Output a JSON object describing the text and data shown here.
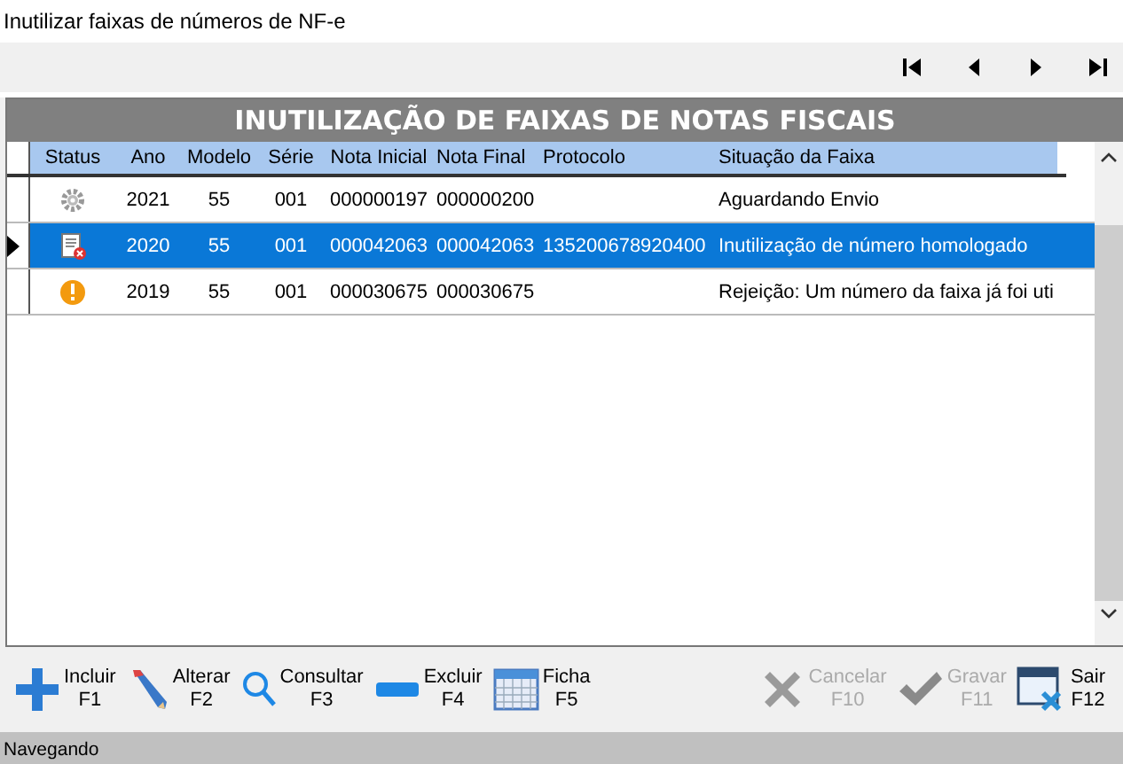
{
  "window": {
    "title": "Inutilizar faixas de números de NF-e"
  },
  "navigator": [
    {
      "kind": "first"
    },
    {
      "kind": "prev"
    },
    {
      "kind": "next"
    },
    {
      "kind": "last"
    }
  ],
  "grid": {
    "title": "INUTILIZAÇÃO DE FAIXAS DE NOTAS FISCAIS",
    "columns": [
      "Status",
      "Ano",
      "Modelo",
      "Série",
      "Nota Inicial",
      "Nota Final",
      "Protocolo",
      "Situação da Faixa"
    ],
    "rows": [
      {
        "kind": "processing",
        "selected": false,
        "cells": [
          "",
          "2021",
          "55",
          "001",
          "000000197",
          "000000200",
          "",
          "Aguardando Envio"
        ]
      },
      {
        "kind": "cancelled",
        "selected": true,
        "cells": [
          "",
          "2020",
          "55",
          "001",
          "000042063",
          "000042063",
          "135200678920400",
          "Inutilização de número homologado"
        ]
      },
      {
        "kind": "warning",
        "selected": false,
        "cells": [
          "",
          "2019",
          "55",
          "001",
          "000030675",
          "000030675",
          "",
          "Rejeição: Um número da faixa já foi uti"
        ]
      }
    ]
  },
  "toolbar": [
    {
      "kind": "add",
      "label": "Incluir",
      "key": "F1",
      "disabled": false
    },
    {
      "kind": "edit",
      "label": "Alterar",
      "key": "F2",
      "disabled": false
    },
    {
      "kind": "search",
      "label": "Consultar",
      "key": "F3",
      "disabled": false
    },
    {
      "kind": "remove",
      "label": "Excluir",
      "key": "F4",
      "disabled": false
    },
    {
      "kind": "form",
      "label": "Ficha",
      "key": "F5",
      "disabled": false
    },
    {
      "kind": "cancel",
      "label": "Cancelar",
      "key": "F10",
      "disabled": true
    },
    {
      "kind": "save",
      "label": "Gravar",
      "key": "F11",
      "disabled": true
    },
    {
      "kind": "exit",
      "label": "Sair",
      "key": "F12",
      "disabled": false
    }
  ],
  "status_bar": "Navegando"
}
